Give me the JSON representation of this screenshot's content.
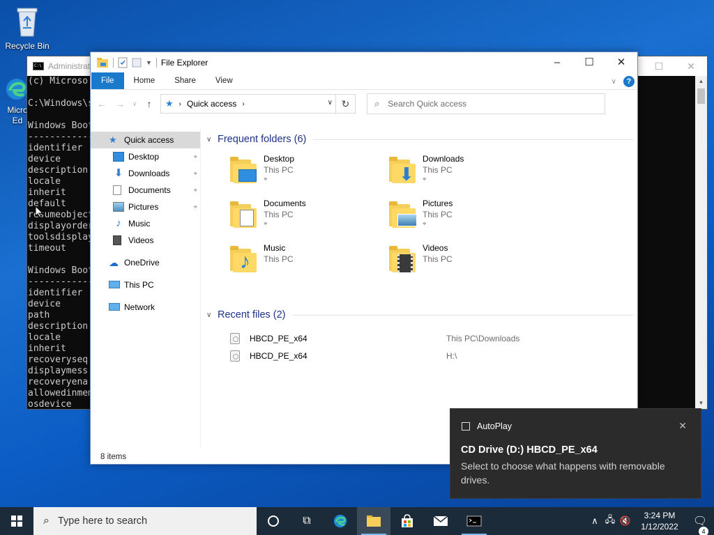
{
  "desktop": {
    "recycle_bin_label": "Recycle Bin",
    "edge_label": "Micro Ed"
  },
  "cmd": {
    "title": "Administrat",
    "lines": "(c) Microso\n\nC:\\Windows\\s\n\nWindows Boot\n------------\nidentifier\ndevice\ndescription\nlocale\ninherit\ndefault\nresumeobject\ndisplayorder\ntoolsdisplay\ntimeout\n\nWindows Boot\n------------\nidentifier\ndevice\npath\ndescription\nlocale\ninherit\nrecoveryseq\ndisplaymess\nrecoveryena\nallowedinmem\nosdevice"
  },
  "explorer": {
    "title": "File Explorer",
    "tabs": [
      "File",
      "Home",
      "Share",
      "View"
    ],
    "address": {
      "crumb": "Quick access"
    },
    "search": {
      "placeholder": "Search Quick access"
    },
    "nav": {
      "quick_access": "Quick access",
      "desktop": "Desktop",
      "downloads": "Downloads",
      "documents": "Documents",
      "pictures": "Pictures",
      "music": "Music",
      "videos": "Videos",
      "onedrive": "OneDrive",
      "this_pc": "This PC",
      "network": "Network"
    },
    "frequent": {
      "heading": "Frequent folders (6)",
      "items": [
        {
          "name": "Desktop",
          "location": "This PC"
        },
        {
          "name": "Downloads",
          "location": "This PC"
        },
        {
          "name": "Documents",
          "location": "This PC"
        },
        {
          "name": "Pictures",
          "location": "This PC"
        },
        {
          "name": "Music",
          "location": "This PC"
        },
        {
          "name": "Videos",
          "location": "This PC"
        }
      ]
    },
    "recent": {
      "heading": "Recent files (2)",
      "items": [
        {
          "name": "HBCD_PE_x64",
          "path": "This PC\\Downloads"
        },
        {
          "name": "HBCD_PE_x64",
          "path": "H:\\"
        }
      ]
    },
    "status": "8 items"
  },
  "toast": {
    "app": "AutoPlay",
    "title": "CD Drive (D:) HBCD_PE_x64",
    "body": "Select to choose what happens with removable drives."
  },
  "taskbar": {
    "search_placeholder": "Type here to search",
    "time": "3:24 PM",
    "date": "1/12/2022",
    "notification_count": "4"
  },
  "colors": {
    "ribbon_file_tab": "#1979ca",
    "nav_selected": "#cce8ff",
    "group_heading": "#1e3287",
    "toast_bg": "#2b2b2b",
    "taskbar_bg": "#1c2b3a"
  }
}
